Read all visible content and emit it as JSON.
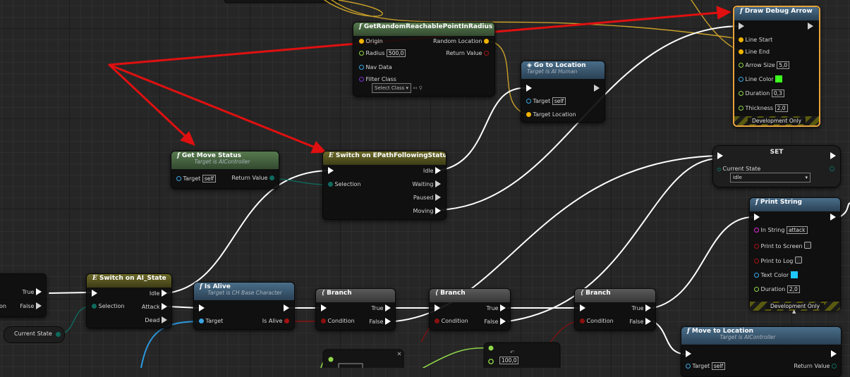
{
  "nodes": {
    "draw_debug_arrow": {
      "title": "Draw Debug Arrow",
      "pins": {
        "line_start": "Line Start",
        "line_end": "Line End",
        "arrow_size": "Arrow Size",
        "arrow_size_val": "5,0",
        "line_color": "Line Color",
        "duration": "Duration",
        "duration_val": "0,3",
        "thickness": "Thickness",
        "thickness_val": "2,0"
      },
      "footer": "Development Only",
      "line_color_hex": "#3cff1e"
    },
    "get_random_point": {
      "title": "GetRandomReachablePointInRadius",
      "pins": {
        "origin": "Origin",
        "radius": "Radius",
        "radius_val": "500,0",
        "nav_data": "Nav Data",
        "filter_class": "Filter Class",
        "filter_val": "Select Class",
        "random_location": "Random Location",
        "return_value": "Return Value"
      }
    },
    "go_to_location": {
      "title": "Go to Location",
      "subtitle": "Target is AI Human",
      "pins": {
        "target": "Target",
        "target_val": "self",
        "target_location": "Target Location"
      }
    },
    "get_move_status": {
      "title": "Get Move Status",
      "subtitle": "Target is AIController",
      "pins": {
        "target": "Target",
        "target_val": "self",
        "return_value": "Return Value"
      }
    },
    "switch_path": {
      "title": "Switch on EPathFollowingStatus",
      "pins": {
        "selection": "Selection",
        "idle": "Idle",
        "waiting": "Waiting",
        "paused": "Paused",
        "moving": "Moving"
      }
    },
    "set_node": {
      "title": "SET",
      "pins": {
        "current_state": "Current State",
        "state_val": "Idle"
      }
    },
    "print_string": {
      "title": "Print String",
      "pins": {
        "in_string": "In String",
        "in_string_val": "attack",
        "print_screen": "Print to Screen",
        "print_log": "Print to Log",
        "text_color": "Text Color",
        "duration": "Duration",
        "duration_val": "2,0"
      },
      "footer": "Development Only",
      "text_color_hex": "#1ec8ff"
    },
    "left_partial": {
      "true": "True",
      "false": "False",
      "on": "on"
    },
    "current_state_var": {
      "label": "Current State"
    },
    "switch_ai": {
      "title": "Switch on AI_State",
      "pins": {
        "selection": "Selection",
        "idle": "Idle",
        "attack": "Attack",
        "dead": "Dead"
      }
    },
    "is_alive": {
      "title": "Is Alive",
      "subtitle": "Target is CH Base Character",
      "pins": {
        "target": "Target",
        "is_alive": "Is Alive"
      }
    },
    "branch1": {
      "title": "Branch",
      "pins": {
        "condition": "Condition",
        "true": "True",
        "false": "False"
      }
    },
    "branch2": {
      "title": "Branch",
      "pins": {
        "condition": "Condition",
        "true": "True",
        "false": "False"
      }
    },
    "branch3": {
      "title": "Branch",
      "pins": {
        "condition": "Condition",
        "true": "True",
        "false": "False"
      }
    },
    "move_to_location": {
      "title": "Move to Location",
      "subtitle": "Target is AIController",
      "pins": {
        "target": "Target",
        "target_val": "self",
        "return_value": "Return Value"
      }
    },
    "bottom_val": {
      "value": "100,0"
    }
  },
  "colors": {
    "annotation_arrow": "#e01010",
    "exec_wire": "#ffffff",
    "vector_pin": "#f0b400",
    "float_pin": "#9ee05a",
    "object_pin": "#3aa6e6",
    "bool_pin": "#a51212",
    "enum_pin": "#0f6a5e",
    "string_pin": "#e32ed8",
    "class_pin": "#7a2fd1",
    "selected_border": "#e8a33a"
  },
  "icons": {
    "function": "function-icon",
    "switch": "switch-icon",
    "event": "event-icon",
    "branch": "branch-icon"
  }
}
